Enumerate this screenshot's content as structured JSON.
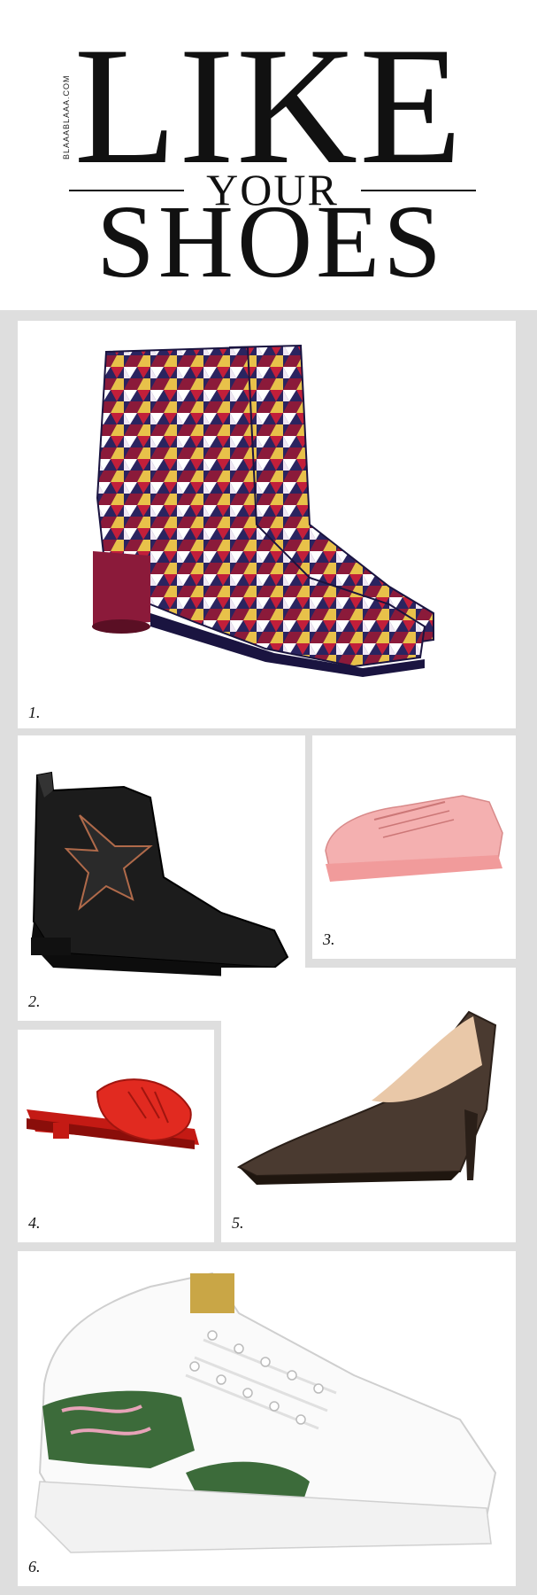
{
  "header": {
    "line1": "LIKE",
    "line2": "YOUR",
    "line3": "SHOES",
    "side_credit": "BLAAABLAAA.COM"
  },
  "items": [
    {
      "number": "1.",
      "icon": "geometric-print-ankle-boot-image"
    },
    {
      "number": "2.",
      "icon": "black-star-chelsea-boot-image"
    },
    {
      "number": "3.",
      "icon": "pink-lace-up-sneaker-image"
    },
    {
      "number": "4.",
      "icon": "red-knot-slide-sandal-image"
    },
    {
      "number": "5.",
      "icon": "brown-pointed-pump-image"
    },
    {
      "number": "6.",
      "icon": "floral-white-sneaker-image"
    }
  ],
  "colors": {
    "background": "#dedede",
    "panel": "#ffffff",
    "boot_red": "#8b1a3a",
    "boot_navy": "#2a2460",
    "pink": "#f2a5a5",
    "red": "#e12a20",
    "brown": "#4a3a30",
    "green": "#3c6b3a"
  }
}
